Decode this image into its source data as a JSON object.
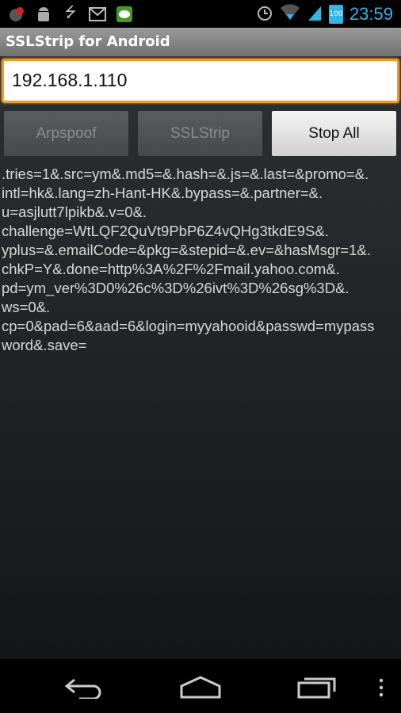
{
  "status_bar": {
    "time": "23:59",
    "battery": "100",
    "icons": [
      "notification-lock-icon",
      "android-debug-icon",
      "usb-icon",
      "gmail-icon",
      "line-app-icon"
    ]
  },
  "app": {
    "title": "SSLStrip for Android"
  },
  "ip_input": {
    "value": "192.168.1.110"
  },
  "buttons": {
    "arpspoof": "Arpspoof",
    "sslstrip": "SSLStrip",
    "stop_all": "Stop All"
  },
  "log_lines": [
    ".tries=1&.src=ym&.md5=&.hash=&.js=&.last=&promo=&.",
    "intl=hk&.lang=zh-Hant-HK&.bypass=&.partner=&.",
    "u=asjlutt7lpikb&.v=0&.",
    "challenge=WtLQF2QuVt9PbP6Z4vQHg3tkdE9S&.",
    "yplus=&.emailCode=&pkg=&stepid=&.ev=&hasMsgr=1&.",
    "chkP=Y&.done=http%3A%2F%2Fmail.yahoo.com&.",
    "pd=ym_ver%3D0%26c%3D%26ivt%3D%26sg%3D&.",
    "ws=0&.",
    "cp=0&pad=6&aad=6&login=myyahooid&passwd=mypass",
    "word&.save="
  ],
  "colors": {
    "accent": "#f39a1d",
    "clock": "#33b5e5"
  }
}
